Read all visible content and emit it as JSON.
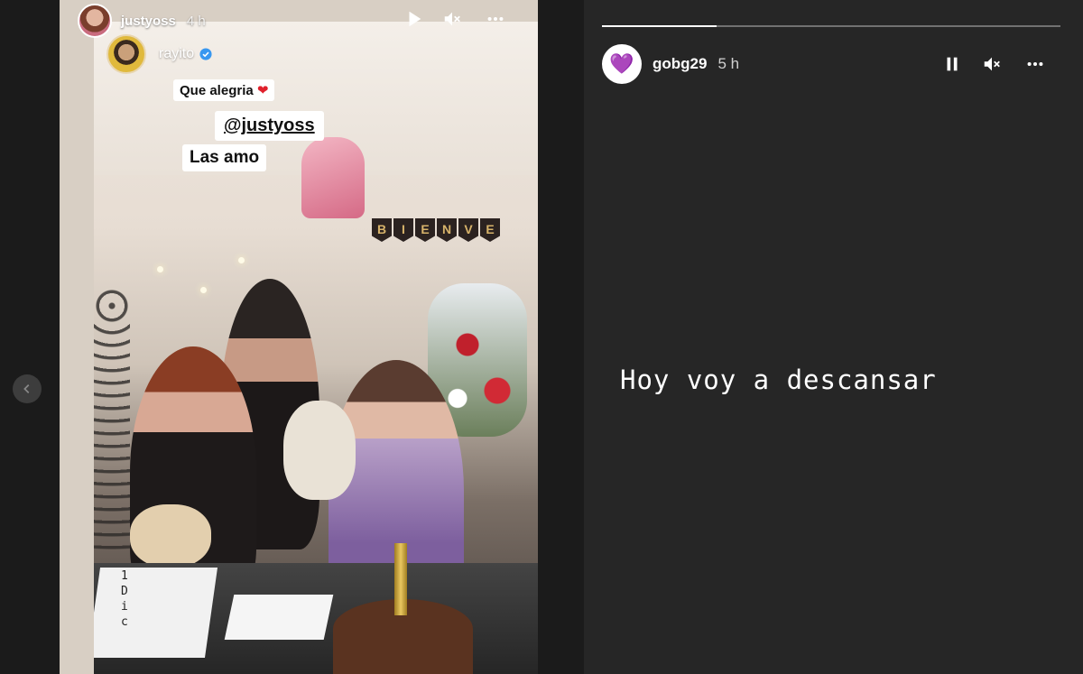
{
  "left_story": {
    "username": "justyoss",
    "time": "4 h",
    "shared_from": {
      "username": "rayito",
      "verified": true
    },
    "stickers": [
      "Que alegria",
      "@justyoss",
      "Las amo"
    ],
    "heart_emoji": "❤",
    "banner_letters": [
      "B",
      "I",
      "E",
      "N",
      "V",
      "E"
    ],
    "date_text": [
      "1",
      "D",
      "i",
      "c"
    ],
    "controls": [
      "play-icon",
      "mute-icon",
      "more-icon"
    ]
  },
  "right_story": {
    "username": "gobg29",
    "avatar_emoji": "💜",
    "time": "5 h",
    "progress": 0.25,
    "text": "Hoy voy a descansar",
    "controls": [
      "pause-icon",
      "mute-icon",
      "more-icon"
    ]
  },
  "colors": {
    "background": "#1b1b1b",
    "story_bg": "#262626",
    "verified_blue": "#3897f0",
    "heart_red": "#e0202c"
  }
}
